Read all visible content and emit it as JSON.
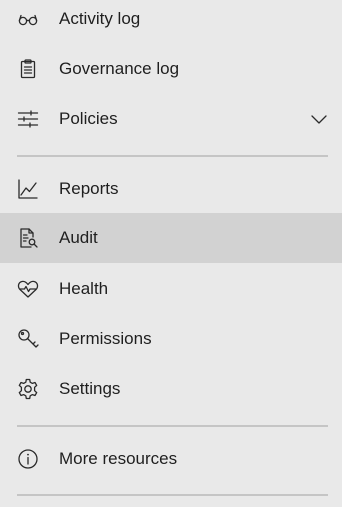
{
  "nav": {
    "items": [
      {
        "label": "Activity log",
        "icon": "glasses-icon"
      },
      {
        "label": "Governance log",
        "icon": "clipboard-icon"
      },
      {
        "label": "Policies",
        "icon": "sliders-icon",
        "expandable": true
      },
      {
        "label": "Reports",
        "icon": "line-chart-icon"
      },
      {
        "label": "Audit",
        "icon": "document-search-icon",
        "selected": true
      },
      {
        "label": "Health",
        "icon": "heart-pulse-icon"
      },
      {
        "label": "Permissions",
        "icon": "key-icon"
      },
      {
        "label": "Settings",
        "icon": "gear-icon"
      },
      {
        "label": "More resources",
        "icon": "info-icon"
      }
    ]
  },
  "colors": {
    "background": "#e9e9e9",
    "selected_background": "#d2d2d2",
    "divider": "#c5c5c5",
    "text": "#1f1f1f"
  }
}
